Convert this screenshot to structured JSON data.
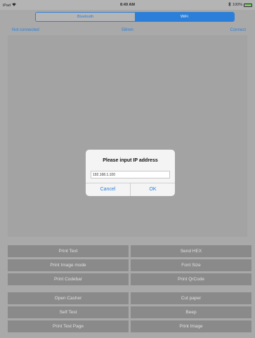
{
  "status_bar": {
    "device": "iPad",
    "wifi_icon": "wifi-icon",
    "time": "8:49 AM",
    "bluetooth_icon": "bluetooth-icon",
    "battery": "100%",
    "battery_level": 1.0,
    "battery_color": "#6bcf52"
  },
  "connection_mode": {
    "options": [
      "Bluetooth",
      "WiFi"
    ],
    "selected": "WiFi",
    "accent": "#2c7fd8"
  },
  "info": {
    "status": "Not connected",
    "paper_width": "58mm",
    "connect_label": "Connect"
  },
  "buttons_group1": [
    "Print Text",
    "Send HEX",
    "Print Image mode",
    "Font Size",
    "Print Codebar",
    "Print QrCode"
  ],
  "buttons_group2": [
    "Open Casher",
    "Cut paper",
    "Self Test",
    "Beep",
    "Print Test Page",
    "Print Image"
  ],
  "dialog": {
    "title": "Please input IP address",
    "ip_value": "192.168.1.100",
    "cancel_label": "Cancel",
    "ok_label": "OK"
  }
}
